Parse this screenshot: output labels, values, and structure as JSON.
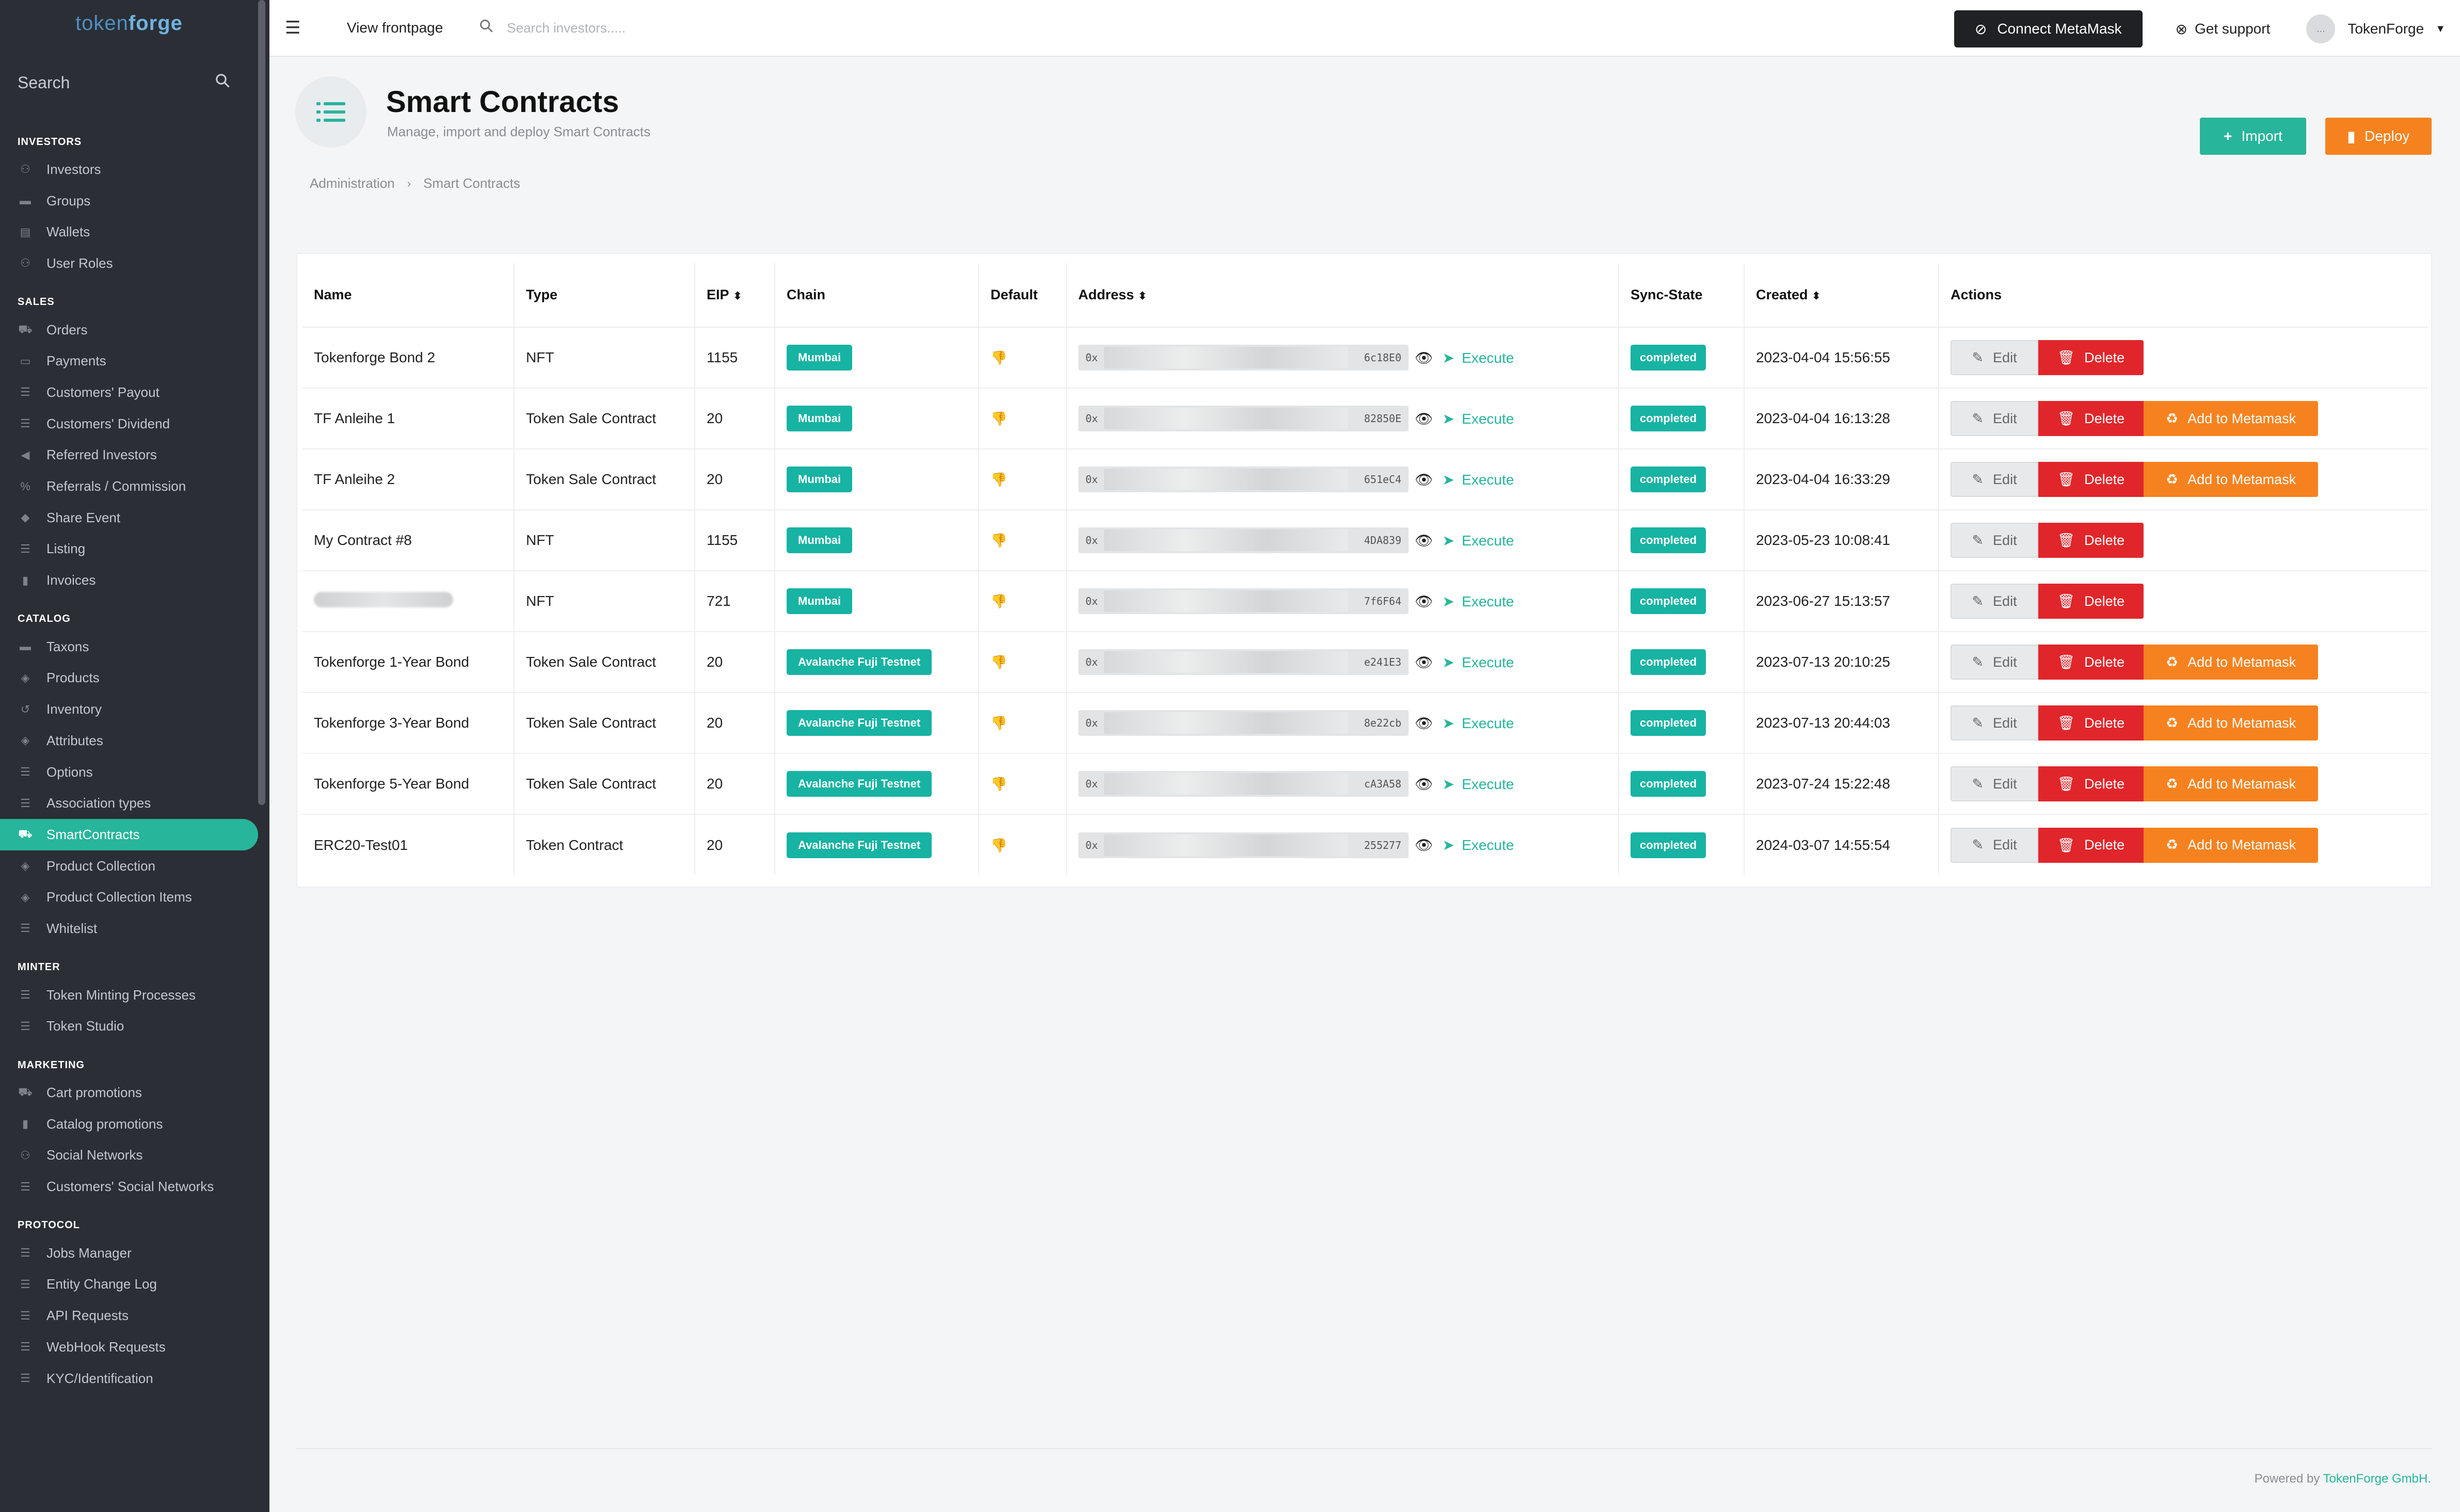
{
  "brand": {
    "logo_light": "token",
    "logo_bold": "forge"
  },
  "sidebar": {
    "search_label": "Search",
    "sections": [
      {
        "title": "INVESTORS",
        "items": [
          "Investors",
          "Groups",
          "Wallets",
          "User Roles"
        ]
      },
      {
        "title": "SALES",
        "items": [
          "Orders",
          "Payments",
          "Customers' Payout",
          "Customers' Dividend",
          "Referred Investors",
          "Referrals / Commission",
          "Share Event",
          "Listing",
          "Invoices"
        ]
      },
      {
        "title": "CATALOG",
        "items": [
          "Taxons",
          "Products",
          "Inventory",
          "Attributes",
          "Options",
          "Association types",
          "SmartContracts",
          "Product Collection",
          "Product Collection Items",
          "Whitelist"
        ]
      },
      {
        "title": "MINTER",
        "items": [
          "Token Minting Processes",
          "Token Studio"
        ]
      },
      {
        "title": "MARKETING",
        "items": [
          "Cart promotions",
          "Catalog promotions",
          "Social Networks",
          "Customers' Social Networks"
        ]
      },
      {
        "title": "PROTOCOL",
        "items": [
          "Jobs Manager",
          "Entity Change Log",
          "API Requests",
          "WebHook Requests",
          "KYC/Identification"
        ]
      }
    ]
  },
  "topbar": {
    "view_frontpage": "View frontpage",
    "search_placeholder": "Search investors.....",
    "connect_metamask": "Connect MetaMask",
    "get_support": "Get support",
    "user_name": "TokenForge",
    "avatar_text": "..."
  },
  "page": {
    "title": "Smart Contracts",
    "subtitle": "Manage, import and deploy Smart Contracts",
    "breadcrumb": [
      "Administration",
      "Smart Contracts"
    ],
    "import_label": "Import",
    "deploy_label": "Deploy"
  },
  "table": {
    "headers": {
      "name": "Name",
      "type": "Type",
      "eip": "EIP",
      "chain": "Chain",
      "default": "Default",
      "address": "Address",
      "sync": "Sync-State",
      "created": "Created",
      "actions": "Actions"
    },
    "edit_label": "Edit",
    "delete_label": "Delete",
    "metamask_label": "Add to Metamask",
    "execute_label": "Execute",
    "rows": [
      {
        "name": "Tokenforge Bond 2",
        "type": "NFT",
        "eip": "1155",
        "chain": "Mumbai",
        "addr_prefix": "0x",
        "addr_suffix": "6c18E0",
        "sync": "completed",
        "created": "2023-04-04 15:56:55"
      },
      {
        "name": "TF Anleihe 1",
        "type": "Token Sale Contract",
        "eip": "20",
        "chain": "Mumbai",
        "addr_prefix": "0x",
        "addr_suffix": "82850E",
        "sync": "completed",
        "created": "2023-04-04 16:13:28"
      },
      {
        "name": "TF Anleihe 2",
        "type": "Token Sale Contract",
        "eip": "20",
        "chain": "Mumbai",
        "addr_prefix": "0x",
        "addr_suffix": "651eC4",
        "sync": "completed",
        "created": "2023-04-04 16:33:29"
      },
      {
        "name": "My Contract #8",
        "type": "NFT",
        "eip": "1155",
        "chain": "Mumbai",
        "addr_prefix": "0x",
        "addr_suffix": "4DA839",
        "sync": "completed",
        "created": "2023-05-23 10:08:41"
      },
      {
        "name": "",
        "type": "NFT",
        "eip": "721",
        "chain": "Mumbai",
        "addr_prefix": "0x",
        "addr_suffix": "7f6F64",
        "sync": "completed",
        "created": "2023-06-27 15:13:57"
      },
      {
        "name": "Tokenforge 1-Year Bond",
        "type": "Token Sale Contract",
        "eip": "20",
        "chain": "Avalanche Fuji Testnet",
        "addr_prefix": "0x",
        "addr_suffix": "e241E3",
        "sync": "completed",
        "created": "2023-07-13 20:10:25"
      },
      {
        "name": "Tokenforge 3-Year Bond",
        "type": "Token Sale Contract",
        "eip": "20",
        "chain": "Avalanche Fuji Testnet",
        "addr_prefix": "0x",
        "addr_suffix": "8e22cb",
        "sync": "completed",
        "created": "2023-07-13 20:44:03"
      },
      {
        "name": "Tokenforge 5-Year Bond",
        "type": "Token Sale Contract",
        "eip": "20",
        "chain": "Avalanche Fuji Testnet",
        "addr_prefix": "0x",
        "addr_suffix": "cA3A58",
        "sync": "completed",
        "created": "2023-07-24 15:22:48"
      },
      {
        "name": "ERC20-Test01",
        "type": "Token Contract",
        "eip": "20",
        "chain": "Avalanche Fuji Testnet",
        "addr_prefix": "0x",
        "addr_suffix": "255277",
        "sync": "completed",
        "created": "2024-03-07 14:55:54"
      }
    ]
  },
  "footer": {
    "powered_by": "Powered by",
    "company": "TokenForge GmbH."
  },
  "colors": {
    "accent": "#27b59b",
    "danger": "#e0262b",
    "orange": "#f6821f",
    "sidebar_bg": "#2b2e35"
  }
}
